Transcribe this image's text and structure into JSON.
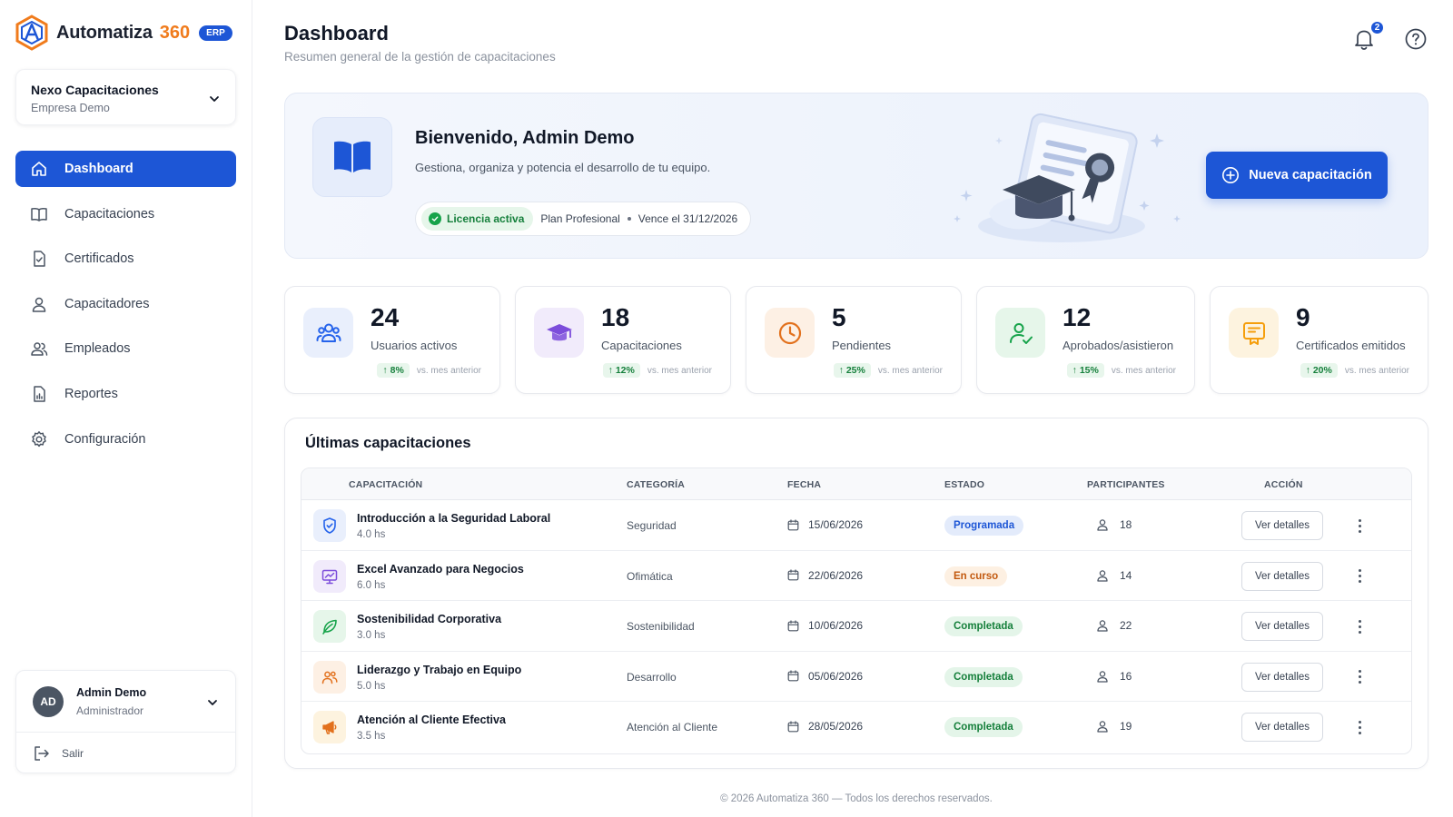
{
  "brand": {
    "name": "Automatiza",
    "number": "360",
    "badge": "ERP"
  },
  "company": {
    "name": "Nexo Capacitaciones",
    "subtitle": "Empresa Demo"
  },
  "nav": [
    {
      "label": "Dashboard",
      "icon": "home-icon",
      "active": true
    },
    {
      "label": "Capacitaciones",
      "icon": "book-icon"
    },
    {
      "label": "Certificados",
      "icon": "certificate-icon"
    },
    {
      "label": "Capacitadores",
      "icon": "user-icon"
    },
    {
      "label": "Empleados",
      "icon": "users-icon"
    },
    {
      "label": "Reportes",
      "icon": "report-icon"
    },
    {
      "label": "Configuración",
      "icon": "gear-icon"
    }
  ],
  "user": {
    "initials": "AD",
    "name": "Admin Demo",
    "role": "Administrador",
    "logout": "Salir"
  },
  "header": {
    "title": "Dashboard",
    "subtitle": "Resumen general de la gestión de capacitaciones",
    "notifications": "2"
  },
  "welcome": {
    "title": "Bienvenido, Admin Demo",
    "subtitle": "Gestiona, organiza y potencia el desarrollo de tu equipo.",
    "license_status": "Licencia activa",
    "plan": "Plan Profesional",
    "expiry": "Vence el 31/12/2026",
    "cta": "Nueva capacitación"
  },
  "stats": [
    {
      "value": "24",
      "label": "Usuarios activos",
      "delta": "8%",
      "note": "vs. mes anterior",
      "icon": "users-icon",
      "color": "#2563eb",
      "bg": "#e9effc"
    },
    {
      "value": "18",
      "label": "Capacitaciones",
      "delta": "12%",
      "note": "vs. mes anterior",
      "icon": "graduation-cap-icon",
      "color": "#7c4ddb",
      "bg": "#f1ebfb"
    },
    {
      "value": "5",
      "label": "Pendientes",
      "delta": "25%",
      "note": "vs. mes anterior",
      "icon": "clock-icon",
      "color": "#e2711d",
      "bg": "#fdf0e4"
    },
    {
      "value": "12",
      "label": "Aprobados/asistieron",
      "delta": "15%",
      "note": "vs. mes anterior",
      "icon": "user-check-icon",
      "color": "#16a34a",
      "bg": "#e6f6ea"
    },
    {
      "value": "9",
      "label": "Certificados emitidos",
      "delta": "20%",
      "note": "vs. mes anterior",
      "icon": "certificate-icon",
      "color": "#f59e0b",
      "bg": "#fdf3df"
    }
  ],
  "table": {
    "title": "Últimas capacitaciones",
    "columns": [
      "CAPACITACIÓN",
      "CATEGORÍA",
      "FECHA",
      "ESTADO",
      "PARTICIPANTES",
      "ACCIÓN"
    ],
    "action_label": "Ver detalles",
    "rows": [
      {
        "name": "Introducción a la Seguridad Laboral",
        "hours": "4.0 hs",
        "category": "Seguridad",
        "date": "15/06/2026",
        "status": "Programada",
        "participants": "18",
        "icon": "shield-icon",
        "color": "#2563eb",
        "bg": "#e9effc",
        "status_color": "#1d56d6",
        "status_bg": "#e3ebfb"
      },
      {
        "name": "Excel Avanzado para Negocios",
        "hours": "6.0 hs",
        "category": "Ofimática",
        "date": "22/06/2026",
        "status": "En curso",
        "participants": "14",
        "icon": "monitor-chart-icon",
        "color": "#7c4ddb",
        "bg": "#f1ebfb",
        "status_color": "#c2590f",
        "status_bg": "#fdf0e2"
      },
      {
        "name": "Sostenibilidad Corporativa",
        "hours": "3.0 hs",
        "category": "Sostenibilidad",
        "date": "10/06/2026",
        "status": "Completada",
        "participants": "22",
        "icon": "leaf-icon",
        "color": "#16a34a",
        "bg": "#e6f6ea",
        "status_color": "#16803c",
        "status_bg": "#e4f5e9"
      },
      {
        "name": "Liderazgo y Trabajo en Equipo",
        "hours": "5.0 hs",
        "category": "Desarrollo",
        "date": "05/06/2026",
        "status": "Completada",
        "participants": "16",
        "icon": "team-icon",
        "color": "#e2711d",
        "bg": "#fdf0e4",
        "status_color": "#16803c",
        "status_bg": "#e4f5e9"
      },
      {
        "name": "Atención al Cliente Efectiva",
        "hours": "3.5 hs",
        "category": "Atención al Cliente",
        "date": "28/05/2026",
        "status": "Completada",
        "participants": "19",
        "icon": "megaphone-icon",
        "color": "#e2711d",
        "bg": "#fdf3df",
        "status_color": "#16803c",
        "status_bg": "#e4f5e9"
      }
    ]
  },
  "footer": "© 2026 Automatiza 360 — Todos los derechos reservados."
}
